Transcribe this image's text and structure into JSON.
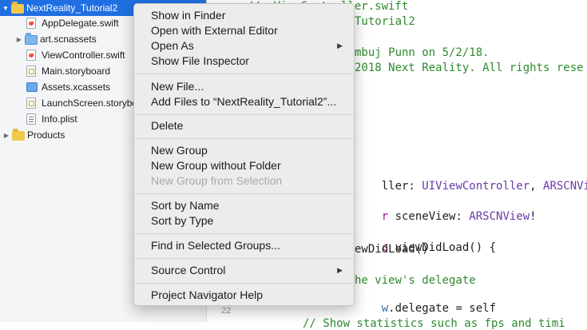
{
  "navigator": {
    "items": [
      {
        "label": "NextReality_Tutorial2",
        "icon": "yellow-folder-icon",
        "disclosure": "▼"
      },
      {
        "label": "AppDelegate.swift",
        "icon": "swift-file-icon"
      },
      {
        "label": "art.scnassets",
        "icon": "blue-folder-icon",
        "disclosure": "▶"
      },
      {
        "label": "ViewController.swift",
        "icon": "swift-file-icon"
      },
      {
        "label": "Main.storyboard",
        "icon": "storyboard-file-icon"
      },
      {
        "label": "Assets.xcassets",
        "icon": "asset-catalog-icon"
      },
      {
        "label": "LaunchScreen.storyboard",
        "icon": "storyboard-file-icon"
      },
      {
        "label": "Info.plist",
        "icon": "plist-file-icon"
      },
      {
        "label": "Products",
        "icon": "yellow-folder-icon",
        "disclosure": "▶"
      }
    ]
  },
  "editor": {
    "lines": [
      {
        "comment": "//  ViewController.swift"
      },
      {
        "comment": "Tutorial2"
      },
      {
        "comment": "mbuj Punn on 5/2/18."
      },
      {
        "comment": "2018 Next Reality. All rights rese"
      },
      {
        "prefix": "ller: ",
        "type1": "UIViewController",
        "sep": ", ",
        "type2": "ARSCNViewD"
      },
      {
        "kw": "r ",
        "name": "sceneView: ",
        "type": "ARSCNView",
        "suffix": "!"
      },
      {
        "kw": "c ",
        "text": "viewDidLoad() {"
      },
      {
        "text": "ewDidLoad()"
      },
      {
        "comment": "he view's delegate"
      },
      {
        "member": "w",
        "rest": ".delegate = self"
      },
      {
        "comment": "// Show statistics such as fps and timi"
      }
    ],
    "gutter_line": "22"
  },
  "menu": {
    "show_in_finder": "Show in Finder",
    "open_external": "Open with External Editor",
    "open_as": "Open As",
    "show_inspector": "Show File Inspector",
    "new_file": "New File...",
    "add_files": "Add Files to “NextReality_Tutorial2”...",
    "delete": "Delete",
    "new_group": "New Group",
    "new_group_no_folder": "New Group without Folder",
    "new_group_selection": "New Group from Selection",
    "sort_name": "Sort by Name",
    "sort_type": "Sort by Type",
    "find_groups": "Find in Selected Groups...",
    "source_control": "Source Control",
    "help": "Project Navigator Help",
    "submenu_arrow": "▶"
  },
  "colors": {
    "selection": "#1f6fe2",
    "comment": "#2f8a2f",
    "type": "#6a3aa8",
    "keyword": "#aa0d91"
  }
}
